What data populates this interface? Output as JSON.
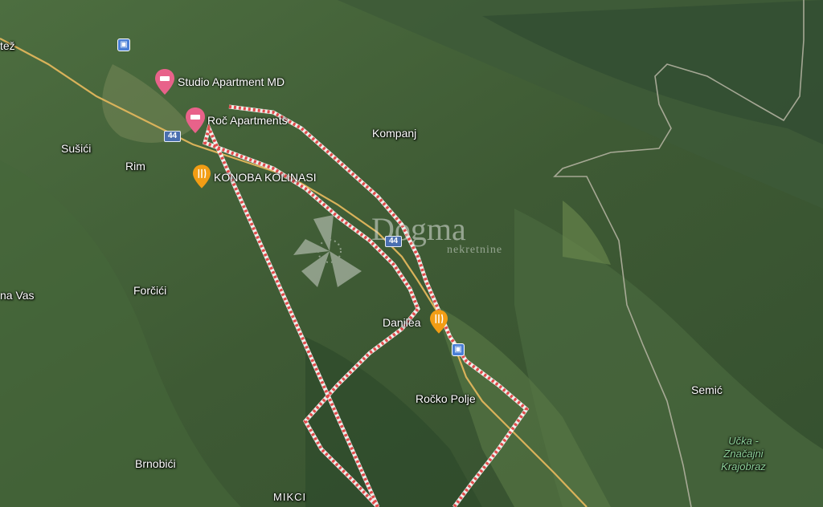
{
  "map": {
    "places": [
      {
        "id": "tez",
        "text": "tež"
      },
      {
        "id": "susici",
        "text": "Sušići"
      },
      {
        "id": "rim",
        "text": "Rim"
      },
      {
        "id": "kompanj",
        "text": "Kompanj"
      },
      {
        "id": "forcici",
        "text": "Forčići"
      },
      {
        "id": "navas",
        "text": "na Vas"
      },
      {
        "id": "brnobici",
        "text": "Brnobići"
      },
      {
        "id": "mikci",
        "text": "MIKCI"
      },
      {
        "id": "rockopolje",
        "text": "Ročko Polje"
      },
      {
        "id": "semic",
        "text": "Semić"
      },
      {
        "id": "ucka",
        "text": "Učka - Značajni Krajobraz"
      }
    ],
    "pois": [
      {
        "id": "studio",
        "text": "Studio Apartment MD",
        "type": "hotel",
        "color": "#e8628a"
      },
      {
        "id": "roc",
        "text": "Roč Apartments",
        "type": "hotel",
        "color": "#e8628a"
      },
      {
        "id": "konoba",
        "text": "KONOBA KOLINASI",
        "type": "restaurant",
        "color": "#f29d14"
      },
      {
        "id": "danilea",
        "text": "Danilea",
        "type": "restaurant",
        "color": "#f29d14"
      }
    ],
    "road_number": "44",
    "watermark": {
      "title": "Dogma",
      "subtitle": "nekretnine"
    },
    "colors": {
      "parcel_border": "#e14a4a",
      "road": "#d9b25a",
      "bus": "#4a7fd6"
    }
  }
}
